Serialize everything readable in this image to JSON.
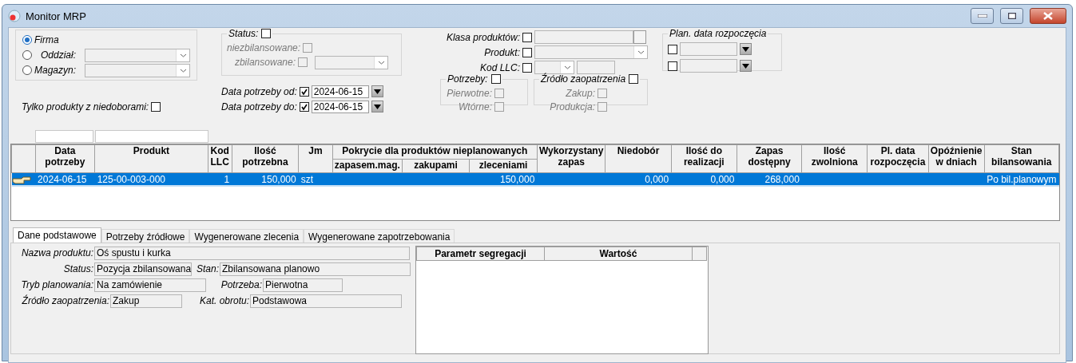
{
  "window": {
    "title": "Monitor MRP"
  },
  "location": {
    "options": [
      {
        "label": "Firma",
        "selected": true,
        "kind": "plain"
      },
      {
        "label": "Oddział:",
        "selected": false,
        "kind": "combo"
      },
      {
        "label": "Magazyn:",
        "selected": false,
        "kind": "combo"
      }
    ]
  },
  "shortage_only": {
    "label": "Tylko produkty z niedoborami:",
    "checked": false
  },
  "status": {
    "label": "Status:",
    "checked": false,
    "items": [
      {
        "label": "niezbilansowane:",
        "checked": false,
        "disabled": true,
        "kind": "check"
      },
      {
        "label": "zbilansowane:",
        "checked": false,
        "disabled": true,
        "kind": "combo"
      }
    ]
  },
  "need_dates": [
    {
      "label": "Data potrzeby od:",
      "checked": true,
      "value": "2024-06-15"
    },
    {
      "label": "Data potrzeby do:",
      "checked": true,
      "value": "2024-06-15"
    }
  ],
  "product_filters": [
    {
      "label": "Klasa produktów:",
      "checked": false,
      "kind": "picker"
    },
    {
      "label": "Produkt:",
      "checked": false,
      "kind": "combo"
    },
    {
      "label": "Kod LLC:",
      "checked": false,
      "kind": "llc"
    }
  ],
  "needs": {
    "label": "Potrzeby:",
    "checked": false,
    "items": [
      {
        "label": "Pierwotne:",
        "checked": false,
        "disabled": true
      },
      {
        "label": "Wtórne:",
        "checked": false,
        "disabled": true
      }
    ]
  },
  "supply_source": {
    "label": "Źródło zaopatrzenia",
    "checked": false,
    "items": [
      {
        "label": "Zakup:",
        "checked": false,
        "disabled": true
      },
      {
        "label": "Produkcja:",
        "checked": false,
        "disabled": true
      }
    ]
  },
  "planned_start": {
    "label": "Plan. data rozpoczęcia",
    "rows": [
      {
        "checked": false
      },
      {
        "checked": false
      }
    ]
  },
  "table": {
    "column_groups": [
      {
        "label": "Pokrycie dla produktów nieplanowanych"
      }
    ],
    "columns": [
      {
        "label": "Data potrzeby",
        "kind": "single"
      },
      {
        "label": "Produkt",
        "kind": "single"
      },
      {
        "label": "Kod LLC",
        "kind": "single"
      },
      {
        "label": "Ilość potrzebna",
        "kind": "single"
      },
      {
        "label": "Jm",
        "kind": "single"
      },
      {
        "label": "zapasem.mag.",
        "kind": "grouped"
      },
      {
        "label": "zakupami",
        "kind": "grouped"
      },
      {
        "label": "zleceniami",
        "kind": "grouped"
      },
      {
        "label": "Wykorzystany zapas",
        "kind": "single"
      },
      {
        "label": "Niedobór",
        "kind": "single"
      },
      {
        "label": "Ilość do realizacji",
        "kind": "single"
      },
      {
        "label": "Zapas dostępny",
        "kind": "single"
      },
      {
        "label": "Ilość zwolniona",
        "kind": "single"
      },
      {
        "label": "Pl. data rozpoczęcia",
        "kind": "single"
      },
      {
        "label": "Opóźnienie w dniach",
        "kind": "single"
      },
      {
        "label": "Stan bilansowania",
        "kind": "single"
      }
    ],
    "rows": [
      {
        "selected": true,
        "cells": [
          "2024-06-15",
          "125-00-003-000",
          "1",
          "150,000",
          "szt",
          null,
          null,
          "150,000",
          null,
          "0,000",
          "0,000",
          "268,000",
          null,
          null,
          null,
          "Po bil.planowym"
        ]
      }
    ]
  },
  "tabs": [
    {
      "label": "Dane podstawowe",
      "selected": true
    },
    {
      "label": "Potrzeby źródłowe",
      "selected": false
    },
    {
      "label": "Wygenerowane zlecenia",
      "selected": false
    },
    {
      "label": "Wygenerowane zapotrzebowania",
      "selected": false
    }
  ],
  "details": [
    [
      {
        "label": "Nazwa produktu:",
        "value": "Oś spustu i kurka"
      }
    ],
    [
      {
        "label": "Status:",
        "value": "Pozycja zbilansowana"
      },
      {
        "label": "Stan:",
        "value": "Zbilansowana planowo"
      }
    ],
    [
      {
        "label": "Tryb planowania:",
        "value": "Na zamówienie"
      },
      {
        "label": "Potrzeba:",
        "value": "Pierwotna"
      }
    ],
    [
      {
        "label": "Źródło zaopatrzenia:",
        "value": "Zakup"
      },
      {
        "label": "Kat. obrotu:",
        "value": "Podstawowa"
      }
    ]
  ],
  "segregation": {
    "columns": [
      {
        "label": "Parametr segregacji"
      },
      {
        "label": "Wartość"
      }
    ]
  }
}
